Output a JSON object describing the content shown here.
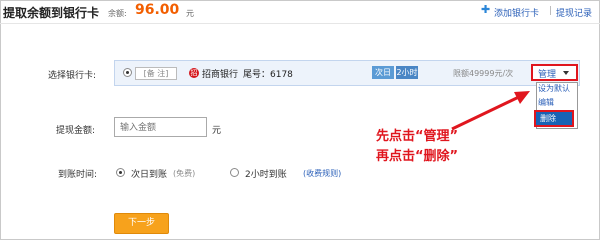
{
  "header": {
    "title": "提取余额到银行卡",
    "balance_label": "余额:",
    "balance_value": "96.00",
    "balance_unit": "元",
    "add_card_link": "添加银行卡",
    "separator": "|",
    "history_link": "提现记录"
  },
  "form": {
    "bank_card_label": "选择银行卡:",
    "amount_label": "提现金额:",
    "arrival_label": "到账时间:"
  },
  "bank_card": {
    "note": "[备 注]",
    "bank_name": "招商银行",
    "tail_number": "尾号：6178",
    "tag_next_day": "次日",
    "tag_two_hours": "2小时",
    "limit": "限额49999元/次",
    "manage_button": "管理",
    "menu": {
      "set_default": "设为默认",
      "edit": "编辑",
      "delete": "删除"
    }
  },
  "amount": {
    "placeholder": "输入金额",
    "unit": "元"
  },
  "arrival_options": [
    {
      "label": "次日到账",
      "note": "(免费)",
      "selected": true
    },
    {
      "label": "2小时到账",
      "note": "",
      "selected": false
    }
  ],
  "fee_rules_link": "(收费规则)",
  "annotation": {
    "line1": "先点击“管理”",
    "line2": "再点击“删除”"
  },
  "next_button": "下一步",
  "colors": {
    "accent_orange": "#f25e00",
    "button_orange": "#f7a21c",
    "link_blue": "#2a5fb8",
    "annotation_red": "#e0161e",
    "selected_menu_blue": "#1863b5"
  }
}
